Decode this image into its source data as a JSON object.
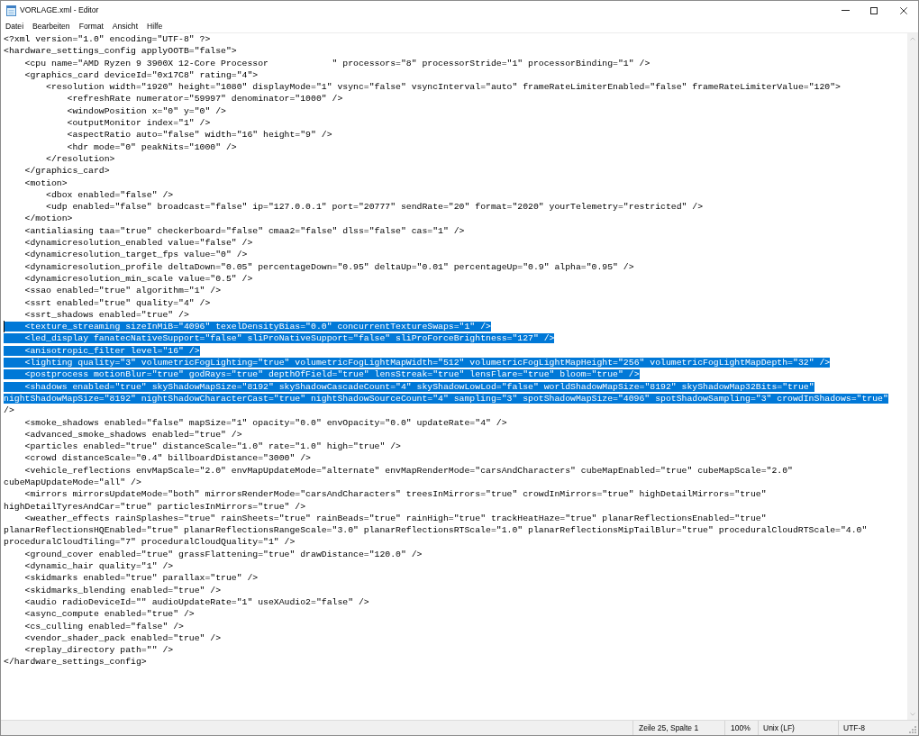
{
  "window": {
    "title": "VORLAGE.xml - Editor"
  },
  "menu_bar": {
    "items": [
      "Datei",
      "Bearbeiten",
      "Format",
      "Ansicht",
      "Hilfe"
    ]
  },
  "editor": {
    "lines": [
      {
        "text": "<?xml version=\"1.0\" encoding=\"UTF-8\" ?>",
        "selected": false,
        "caret": false
      },
      {
        "text": "<hardware_settings_config applyOOTB=\"false\">",
        "selected": false,
        "caret": false
      },
      {
        "text": "\t<cpu name=\"AMD Ryzen 9 3900X 12-Core Processor            \" processors=\"8\" processorStride=\"1\" processorBinding=\"1\" />",
        "selected": false,
        "caret": false
      },
      {
        "text": "\t<graphics_card deviceId=\"0x17C8\" rating=\"4\">",
        "selected": false,
        "caret": false
      },
      {
        "text": "\t\t<resolution width=\"1920\" height=\"1080\" displayMode=\"1\" vsync=\"false\" vsyncInterval=\"auto\" frameRateLimiterEnabled=\"false\" frameRateLimiterValue=\"120\">",
        "selected": false,
        "caret": false
      },
      {
        "text": "\t\t\t<refreshRate numerator=\"59997\" denominator=\"1000\" />",
        "selected": false,
        "caret": false
      },
      {
        "text": "\t\t\t<windowPosition x=\"0\" y=\"0\" />",
        "selected": false,
        "caret": false
      },
      {
        "text": "\t\t\t<outputMonitor index=\"1\" />",
        "selected": false,
        "caret": false
      },
      {
        "text": "\t\t\t<aspectRatio auto=\"false\" width=\"16\" height=\"9\" />",
        "selected": false,
        "caret": false
      },
      {
        "text": "\t\t\t<hdr mode=\"0\" peakNits=\"1000\" />",
        "selected": false,
        "caret": false
      },
      {
        "text": "\t\t</resolution>",
        "selected": false,
        "caret": false
      },
      {
        "text": "\t</graphics_card>",
        "selected": false,
        "caret": false
      },
      {
        "text": "\t<motion>",
        "selected": false,
        "caret": false
      },
      {
        "text": "\t\t<dbox enabled=\"false\" />",
        "selected": false,
        "caret": false
      },
      {
        "text": "\t\t<udp enabled=\"false\" broadcast=\"false\" ip=\"127.0.0.1\" port=\"20777\" sendRate=\"20\" format=\"2020\" yourTelemetry=\"restricted\" />",
        "selected": false,
        "caret": false
      },
      {
        "text": "\t</motion>",
        "selected": false,
        "caret": false
      },
      {
        "text": "\t<antialiasing taa=\"true\" checkerboard=\"false\" cmaa2=\"false\" dlss=\"false\" cas=\"1\" />",
        "selected": false,
        "caret": false
      },
      {
        "text": "\t<dynamicresolution_enabled value=\"false\" />",
        "selected": false,
        "caret": false
      },
      {
        "text": "\t<dynamicresolution_target_fps value=\"0\" />",
        "selected": false,
        "caret": false
      },
      {
        "text": "\t<dynamicresolution_profile deltaDown=\"0.05\" percentageDown=\"0.95\" deltaUp=\"0.01\" percentageUp=\"0.9\" alpha=\"0.95\" />",
        "selected": false,
        "caret": false
      },
      {
        "text": "\t<dynamicresolution_min_scale value=\"0.5\" />",
        "selected": false,
        "caret": false
      },
      {
        "text": "\t<ssao enabled=\"true\" algorithm=\"1\" />",
        "selected": false,
        "caret": false
      },
      {
        "text": "\t<ssrt enabled=\"true\" quality=\"4\" />",
        "selected": false,
        "caret": false
      },
      {
        "text": "\t<ssrt_shadows enabled=\"true\" />",
        "selected": false,
        "caret": false
      },
      {
        "text": "\t<texture_streaming sizeInMiB=\"4096\" texelDensityBias=\"0.0\" concurrentTextureSwaps=\"1\" />",
        "selected": true,
        "caret": true
      },
      {
        "text": "\t<led_display fanatecNativeSupport=\"false\" sliProNativeSupport=\"false\" sliProForceBrightness=\"127\" />",
        "selected": true,
        "caret": false
      },
      {
        "text": "\t<anisotropic_filter level=\"16\" />",
        "selected": true,
        "caret": false
      },
      {
        "text": "\t<lighting quality=\"3\" volumetricFogLighting=\"true\" volumetricFogLightMapWidth=\"512\" volumetricFogLightMapHeight=\"256\" volumetricFogLightMapDepth=\"32\" />",
        "selected": true,
        "caret": false
      },
      {
        "text": "\t<postprocess motionBlur=\"true\" godRays=\"true\" depthOfField=\"true\" lensStreak=\"true\" lensFlare=\"true\" bloom=\"true\" />",
        "selected": true,
        "caret": false
      },
      {
        "text": "\t<shadows enabled=\"true\" skyShadowMapSize=\"8192\" skyShadowCascadeCount=\"4\" skyShadowLowLod=\"false\" worldShadowMapSize=\"8192\" skyShadowMap32Bits=\"true\"",
        "selected": true,
        "caret": false
      },
      {
        "text": "nightShadowMapSize=\"8192\" nightShadowCharacterCast=\"true\" nightShadowSourceCount=\"4\" sampling=\"3\" spotShadowMapSize=\"4096\" spotShadowSampling=\"3\" crowdInShadows=\"true\"",
        "selected": true,
        "caret": false
      },
      {
        "text": "/>",
        "selected": false,
        "caret": false
      },
      {
        "text": "\t<smoke_shadows enabled=\"false\" mapSize=\"1\" opacity=\"0.0\" envOpacity=\"0.0\" updateRate=\"4\" />",
        "selected": false,
        "caret": false
      },
      {
        "text": "\t<advanced_smoke_shadows enabled=\"true\" />",
        "selected": false,
        "caret": false
      },
      {
        "text": "\t<particles enabled=\"true\" distanceScale=\"1.0\" rate=\"1.0\" high=\"true\" />",
        "selected": false,
        "caret": false
      },
      {
        "text": "\t<crowd distanceScale=\"0.4\" billboardDistance=\"3000\" />",
        "selected": false,
        "caret": false
      },
      {
        "text": "\t<vehicle_reflections envMapScale=\"2.0\" envMapUpdateMode=\"alternate\" envMapRenderMode=\"carsAndCharacters\" cubeMapEnabled=\"true\" cubeMapScale=\"2.0\"",
        "selected": false,
        "caret": false
      },
      {
        "text": "cubeMapUpdateMode=\"all\" />",
        "selected": false,
        "caret": false
      },
      {
        "text": "\t<mirrors mirrorsUpdateMode=\"both\" mirrorsRenderMode=\"carsAndCharacters\" treesInMirrors=\"true\" crowdInMirrors=\"true\" highDetailMirrors=\"true\"",
        "selected": false,
        "caret": false
      },
      {
        "text": "highDetailTyresAndCar=\"true\" particlesInMirrors=\"true\" />",
        "selected": false,
        "caret": false
      },
      {
        "text": "\t<weather_effects rainSplashes=\"true\" rainSheets=\"true\" rainBeads=\"true\" rainHigh=\"true\" trackHeatHaze=\"true\" planarReflectionsEnabled=\"true\"",
        "selected": false,
        "caret": false
      },
      {
        "text": "planarReflectionsHQEnabled=\"true\" planarReflectionsRangeScale=\"3.0\" planarReflectionsRTScale=\"1.0\" planarReflectionsMipTailBlur=\"true\" proceduralCloudRTScale=\"4.0\"",
        "selected": false,
        "caret": false
      },
      {
        "text": "proceduralCloudTiling=\"7\" proceduralCloudQuality=\"1\" />",
        "selected": false,
        "caret": false
      },
      {
        "text": "\t<ground_cover enabled=\"true\" grassFlattening=\"true\" drawDistance=\"120.0\" />",
        "selected": false,
        "caret": false
      },
      {
        "text": "\t<dynamic_hair quality=\"1\" />",
        "selected": false,
        "caret": false
      },
      {
        "text": "\t<skidmarks enabled=\"true\" parallax=\"true\" />",
        "selected": false,
        "caret": false
      },
      {
        "text": "\t<skidmarks_blending enabled=\"true\" />",
        "selected": false,
        "caret": false
      },
      {
        "text": "\t<audio radioDeviceId=\"\" audioUpdateRate=\"1\" useXAudio2=\"false\" />",
        "selected": false,
        "caret": false
      },
      {
        "text": "\t<async_compute enabled=\"true\" />",
        "selected": false,
        "caret": false
      },
      {
        "text": "\t<cs_culling enabled=\"false\" />",
        "selected": false,
        "caret": false
      },
      {
        "text": "\t<vendor_shader_pack enabled=\"true\" />",
        "selected": false,
        "caret": false
      },
      {
        "text": "\t<replay_directory path=\"\" />",
        "selected": false,
        "caret": false
      },
      {
        "text": "</hardware_settings_config>",
        "selected": false,
        "caret": false
      }
    ]
  },
  "status_bar": {
    "position": "Zeile 25, Spalte 1",
    "zoom": "100%",
    "line_ending": "Unix (LF)",
    "encoding": "UTF-8"
  }
}
